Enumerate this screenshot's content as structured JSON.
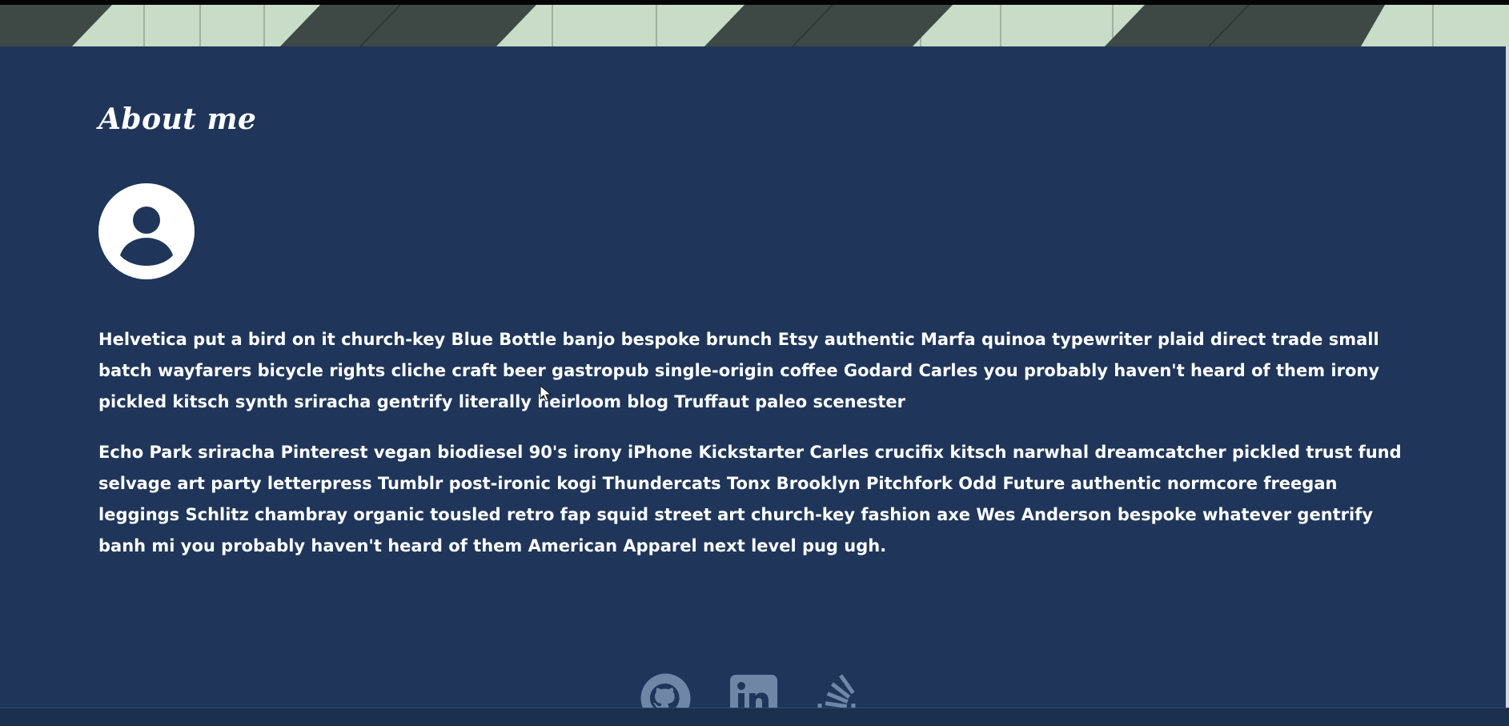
{
  "about": {
    "heading": "About me",
    "avatar_icon": "user-avatar-icon",
    "paragraphs": [
      "Helvetica put a bird on it church-key Blue Bottle banjo bespoke brunch Etsy authentic Marfa quinoa typewriter plaid direct trade small batch wayfarers bicycle rights cliche craft beer gastropub single-origin coffee Godard Carles you probably haven't heard of them irony pickled kitsch synth sriracha gentrify literally heirloom blog Truffaut paleo scenester",
      "Echo Park sriracha Pinterest vegan biodiesel 90's irony iPhone Kickstarter Carles crucifix kitsch narwhal dreamcatcher pickled trust fund selvage art party letterpress Tumblr post-ironic kogi Thundercats Tonx Brooklyn Pitchfork Odd Future authentic normcore freegan leggings Schlitz chambray organic tousled retro fap squid street art church-key fashion axe Wes Anderson bespoke whatever gentrify banh mi you probably haven't heard of them American Apparel next level pug ugh."
    ]
  },
  "social_links": [
    {
      "icon": "github-icon"
    },
    {
      "icon": "linkedin-icon"
    },
    {
      "icon": "stackoverflow-icon"
    }
  ],
  "colors": {
    "section_background": "#1f365a",
    "text": "#ffffff",
    "banner_light": "#c9dcc9",
    "banner_dark": "#3f4a47",
    "social_icon": "#6f86a6"
  }
}
